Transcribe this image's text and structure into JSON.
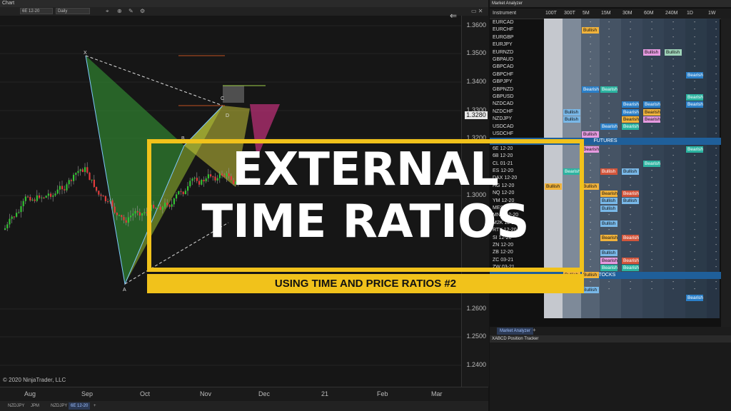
{
  "chart": {
    "title": "Chart",
    "toolbar": {
      "instrument": "6E 12-20",
      "period": "Daily"
    },
    "y_ticks": [
      "1.3600",
      "1.3500",
      "1.3400",
      "1.3300",
      "1.3200",
      "1.3000",
      "1.2600",
      "1.2500",
      "1.2400"
    ],
    "current_price": "1.3280",
    "x_ticks": [
      "Aug",
      "Sep",
      "Oct",
      "Nov",
      "Dec",
      "21",
      "Feb",
      "Mar"
    ],
    "copyright": "© 2020 NinjaTrader, LLC",
    "pattern_points": [
      "X",
      "A",
      "B",
      "C",
      "D"
    ],
    "tabs": [
      "NZDJPY",
      "JPM",
      "NZDJPY",
      "6E 12-20",
      "+"
    ]
  },
  "analyzer": {
    "title": "Market Analyzer",
    "columns": [
      "Instrument",
      "100T",
      "300T",
      "5M",
      "15M",
      "30M",
      "60M",
      "240M",
      "1D",
      "1W"
    ],
    "forex_rows": [
      "EURCAD",
      "EURCHF",
      "EURGBP",
      "EURJPY",
      "EURNZD",
      "GBPAUD",
      "GBPCAD",
      "GBPCHF",
      "GBPJPY",
      "GBPNZD",
      "GBPUSD",
      "NZDCAD",
      "NZDCHF",
      "NZDJPY",
      "USDCAD",
      "USDCHF"
    ],
    "futures_label": "FUTURES",
    "futures_rows": [
      "6E 12-20",
      "6B 12-20",
      "CL 01-21",
      "ES 12-20",
      "DAX 12-20",
      "HG 12-20",
      "NQ 12-20",
      "YM 12-20",
      "MES 12-20",
      "MNQ 12-20",
      "M2K 12-20",
      "RTY 12-20",
      "SI 12-20",
      "ZN 12-20",
      "ZB 12-20",
      "ZC 03-21",
      "ZW 03-21"
    ],
    "stocks_label": "STOCKS",
    "stocks_rows": [
      "AMZN",
      "JPM"
    ],
    "bullish": "Bullish",
    "bearish": "Bearish",
    "dash": "-",
    "tab": "Market Analyzer",
    "tab_add": "+"
  },
  "tracker": {
    "title": "XABCD Position Tracker"
  },
  "overlay": {
    "line1": "EXTERNAL",
    "line2": "TIME RATIOS",
    "subtitle": "USING TIME AND PRICE RATIOS #2"
  }
}
